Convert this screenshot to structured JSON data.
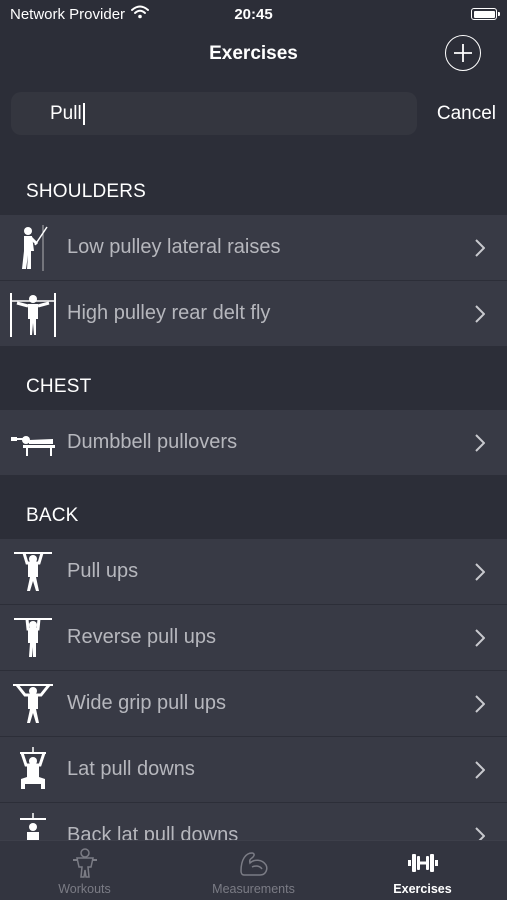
{
  "status": {
    "carrier": "Network Provider",
    "time": "20:45"
  },
  "nav": {
    "title": "Exercises"
  },
  "search": {
    "value": "Pull",
    "cancel_label": "Cancel"
  },
  "sections": [
    {
      "title": "SHOULDERS",
      "items": [
        {
          "label": "Low pulley lateral raises",
          "icon": "cable-lateral-raise-icon"
        },
        {
          "label": "High pulley rear delt fly",
          "icon": "cable-rear-delt-fly-icon"
        }
      ]
    },
    {
      "title": "CHEST",
      "items": [
        {
          "label": "Dumbbell pullovers",
          "icon": "bench-pullover-icon"
        }
      ]
    },
    {
      "title": "BACK",
      "items": [
        {
          "label": "Pull ups",
          "icon": "pull-up-icon"
        },
        {
          "label": "Reverse pull ups",
          "icon": "reverse-pull-up-icon"
        },
        {
          "label": "Wide grip pull ups",
          "icon": "wide-grip-pull-up-icon"
        },
        {
          "label": "Lat pull downs",
          "icon": "lat-pulldown-icon"
        },
        {
          "label": "Back lat pull downs",
          "icon": "back-lat-pulldown-icon"
        }
      ]
    }
  ],
  "tabs": [
    {
      "label": "Workouts",
      "icon": "workouts-icon",
      "active": false
    },
    {
      "label": "Measurements",
      "icon": "measurements-icon",
      "active": false
    },
    {
      "label": "Exercises",
      "icon": "dumbbell-icon",
      "active": true
    }
  ],
  "colors": {
    "background": "#2c2e38",
    "row": "#383a45",
    "row_text": "#b6b7bd",
    "tab_inactive": "#7b7c85",
    "tab_active": "#ffffff"
  }
}
